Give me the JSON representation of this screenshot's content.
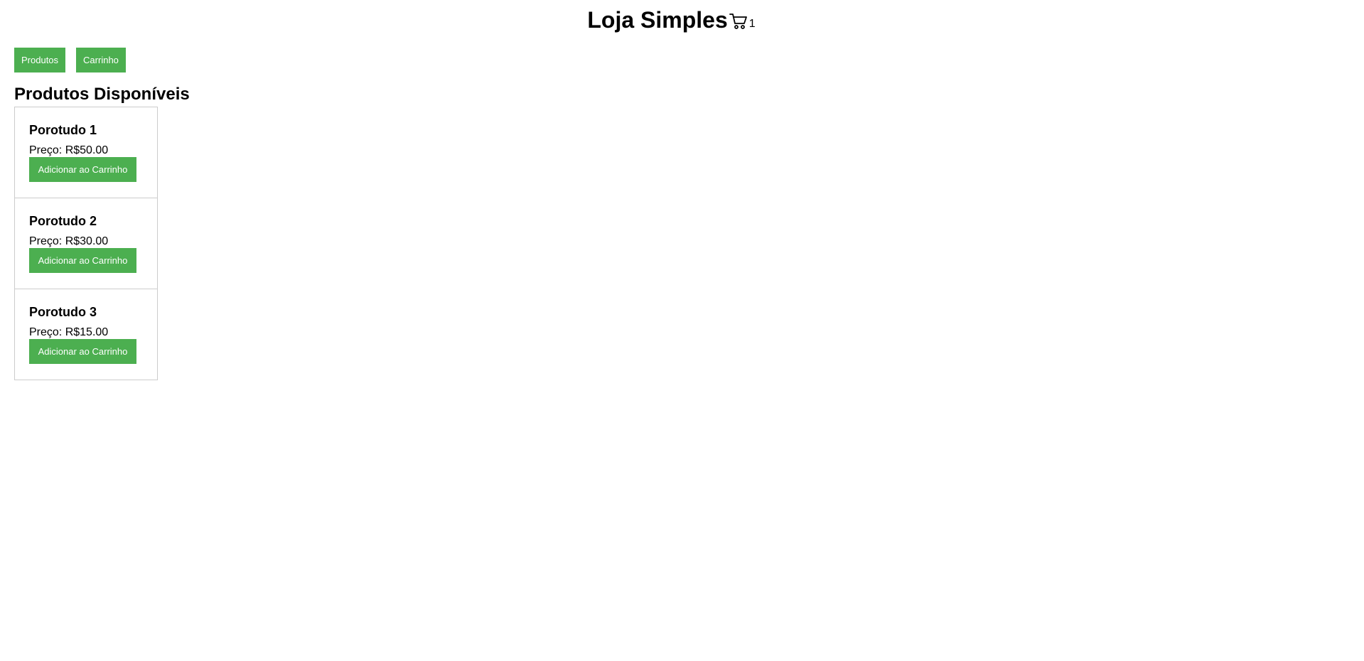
{
  "header": {
    "title": "Loja Simples",
    "cart_icon": "shopping-cart-icon",
    "cart_count": "1"
  },
  "nav": {
    "products_label": "Produtos",
    "cart_label": "Carrinho"
  },
  "products_section": {
    "title": "Produtos Disponíveis",
    "items": [
      {
        "name": "Porotudo 1",
        "price": "Preço: R$50.00",
        "button_label": "Adicionar ao Carrinho"
      },
      {
        "name": "Porotudo 2",
        "price": "Preço: R$30.00",
        "button_label": "Adicionar ao Carrinho"
      },
      {
        "name": "Porotudo 3",
        "price": "Preço: R$15.00",
        "button_label": "Adicionar ao Carrinho"
      }
    ]
  },
  "colors": {
    "accent": "#4caf50",
    "card_border": "#cccccc"
  }
}
